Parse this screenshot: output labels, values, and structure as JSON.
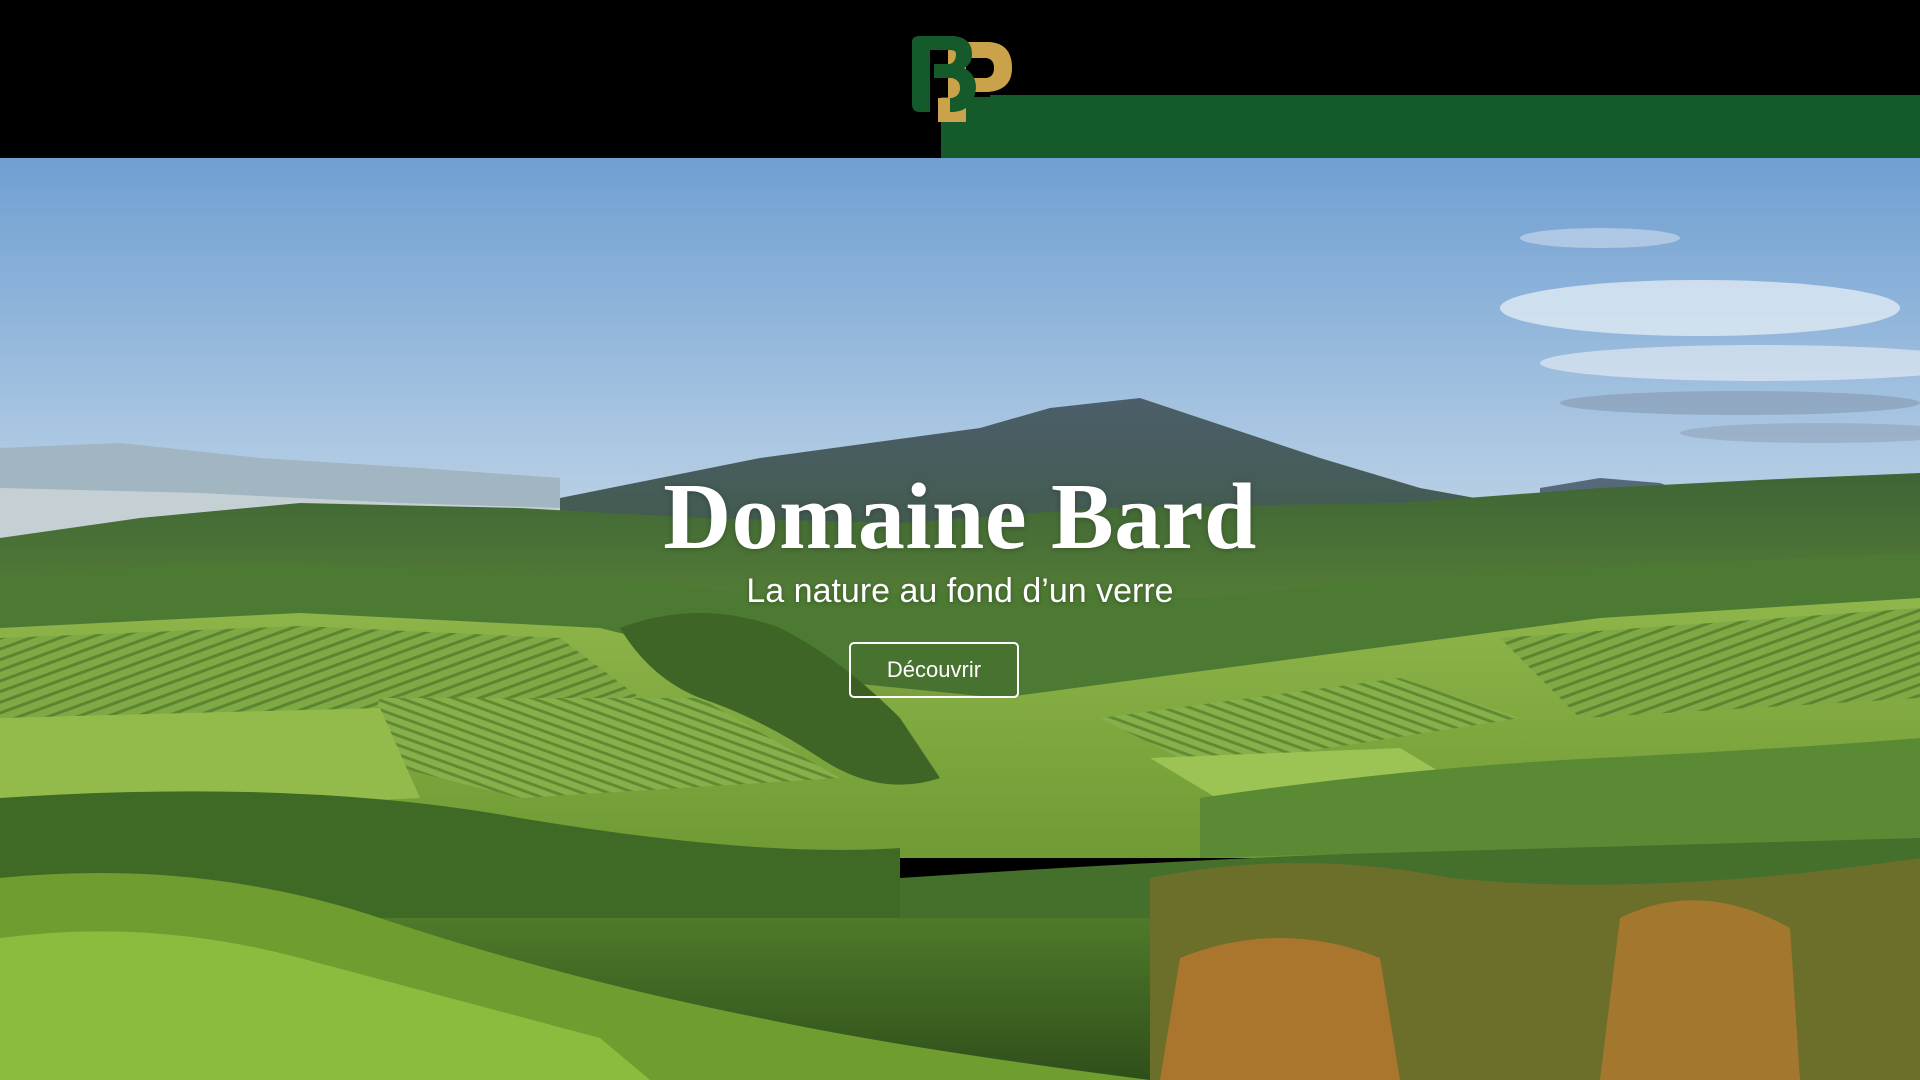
{
  "brand": {
    "logo_icon": "domaine-bard-monogram-icon",
    "logo_colors": {
      "green": "#145a2a",
      "gold": "#c9a24a"
    },
    "header_bg": "#000000",
    "accent_bar": "#145a2a"
  },
  "hero": {
    "title": "Domaine Bard",
    "subtitle": "La nature au fond d’un verre",
    "cta_label": "Découvrir",
    "background": "vineyard-landscape-image"
  }
}
